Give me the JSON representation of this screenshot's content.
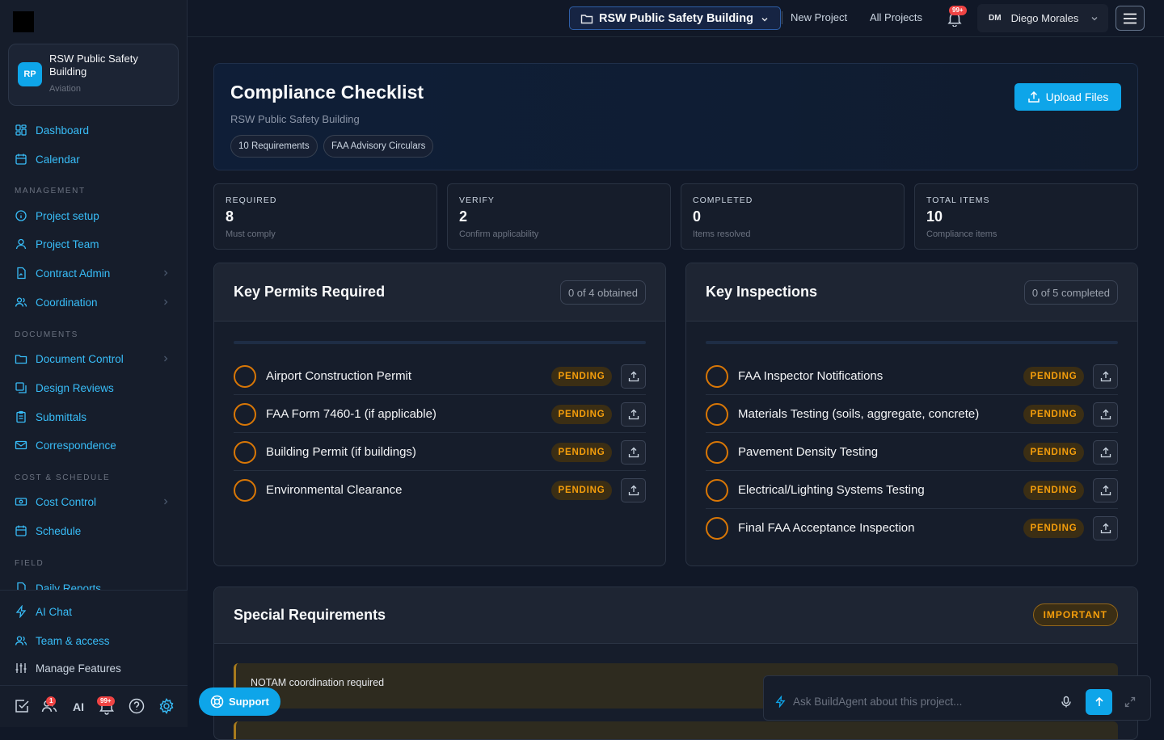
{
  "sidebar": {
    "project": {
      "initials": "RP",
      "name": "RSW Public Safety Building",
      "category": "Aviation"
    },
    "top_items": [
      {
        "label": "Dashboard"
      },
      {
        "label": "Calendar"
      }
    ],
    "sections": [
      {
        "title": "MANAGEMENT",
        "items": [
          {
            "label": "Project setup"
          },
          {
            "label": "Project Team"
          },
          {
            "label": "Contract Admin"
          },
          {
            "label": "Coordination"
          }
        ]
      },
      {
        "title": "DOCUMENTS",
        "items": [
          {
            "label": "Document Control"
          },
          {
            "label": "Design Reviews"
          },
          {
            "label": "Submittals"
          },
          {
            "label": "Correspondence"
          }
        ]
      },
      {
        "title": "COST & SCHEDULE",
        "items": [
          {
            "label": "Cost Control"
          },
          {
            "label": "Schedule"
          }
        ]
      },
      {
        "title": "FIELD",
        "items": [
          {
            "label": "Daily Reports"
          }
        ]
      }
    ],
    "bottom_items": [
      {
        "label": "AI Chat"
      },
      {
        "label": "Team & access"
      },
      {
        "label": "Manage Features"
      }
    ],
    "bottom_bar": {
      "ai_label": "AI",
      "users_badge": "1",
      "notif_badge": "99+"
    }
  },
  "topbar": {
    "project_selector": "RSW Public Safety Building",
    "new_project": "New Project",
    "all_projects": "All Projects",
    "bell_badge": "99+",
    "user": {
      "initials": "DM",
      "name": "Diego Morales"
    }
  },
  "header": {
    "title": "Compliance Checklist",
    "subtitle": "RSW Public Safety Building",
    "chips": [
      "10 Requirements",
      "FAA Advisory Circulars"
    ],
    "upload_label": "Upload Files"
  },
  "stats": [
    {
      "label": "REQUIRED",
      "value": "8",
      "note": "Must comply"
    },
    {
      "label": "VERIFY",
      "value": "2",
      "note": "Confirm applicability"
    },
    {
      "label": "COMPLETED",
      "value": "0",
      "note": "Items resolved"
    },
    {
      "label": "TOTAL ITEMS",
      "value": "10",
      "note": "Compliance items"
    }
  ],
  "permits": {
    "title": "Key Permits Required",
    "count": "0 of 4 obtained",
    "progress": 0,
    "items": [
      {
        "label": "Airport Construction Permit",
        "status": "PENDING"
      },
      {
        "label": "FAA Form 7460-1 (if applicable)",
        "status": "PENDING"
      },
      {
        "label": "Building Permit (if buildings)",
        "status": "PENDING"
      },
      {
        "label": "Environmental Clearance",
        "status": "PENDING"
      }
    ]
  },
  "inspections": {
    "title": "Key Inspections",
    "count": "0 of 5 completed",
    "progress": 0,
    "items": [
      {
        "label": "FAA Inspector Notifications",
        "status": "PENDING"
      },
      {
        "label": "Materials Testing (soils, aggregate, concrete)",
        "status": "PENDING"
      },
      {
        "label": "Pavement Density Testing",
        "status": "PENDING"
      },
      {
        "label": "Electrical/Lighting Systems Testing",
        "status": "PENDING"
      },
      {
        "label": "Final FAA Acceptance Inspection",
        "status": "PENDING"
      }
    ]
  },
  "special": {
    "title": "Special Requirements",
    "badge": "IMPORTANT",
    "items": [
      {
        "label": "NOTAM coordination required"
      }
    ]
  },
  "support_label": "Support",
  "chat": {
    "placeholder": "Ask BuildAgent about this project..."
  },
  "colors": {
    "accent": "#0ea5e9",
    "nav_text": "#38bdf8",
    "pending": "#f59e0b",
    "background": "#111827"
  }
}
